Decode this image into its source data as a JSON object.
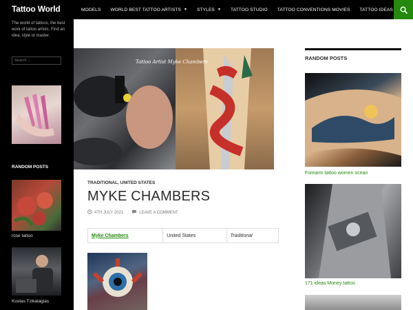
{
  "site": {
    "title": "Tattoo World",
    "tagline": "The world of tattoos, the best work of tattoo artists. Find an idea, style or master."
  },
  "nav": {
    "items": [
      {
        "label": "MODELS",
        "has_dropdown": false
      },
      {
        "label": "WORLD BEST TATTOO ARTISTS",
        "has_dropdown": true
      },
      {
        "label": "STYLES",
        "has_dropdown": true
      },
      {
        "label": "TATTOO STUDIO",
        "has_dropdown": false
      },
      {
        "label": "TATTOO CONVENTIONS MOVIES",
        "has_dropdown": false
      },
      {
        "label": "TATTOO IDEAS",
        "has_dropdown": true
      }
    ],
    "search_icon": "search-icon"
  },
  "left_sidebar": {
    "search_placeholder": "Search …",
    "random_heading": "RANDOM POSTS",
    "posts": [
      {
        "caption": "rose tattoo"
      },
      {
        "caption": "Kostas Tzikalagias"
      }
    ]
  },
  "post": {
    "hero_caption": "Tattoo Artist Myke Chambers",
    "categories": "TRADITIONAL, UNITED STATES",
    "title": "MYKE CHAMBERS",
    "date": "4TH JULY 2021",
    "comment_link": "LEAVE A COMMENT",
    "table": {
      "artist": "Myke Chambers",
      "country": "United States",
      "style": "Traditional"
    }
  },
  "right_sidebar": {
    "heading": "RANDOM POSTS",
    "posts": [
      {
        "caption": "Forearm tattoo women ocean"
      },
      {
        "caption": "171 ideas Money tattoo"
      }
    ]
  },
  "colors": {
    "accent": "#24890d",
    "header_bg": "#000000"
  }
}
